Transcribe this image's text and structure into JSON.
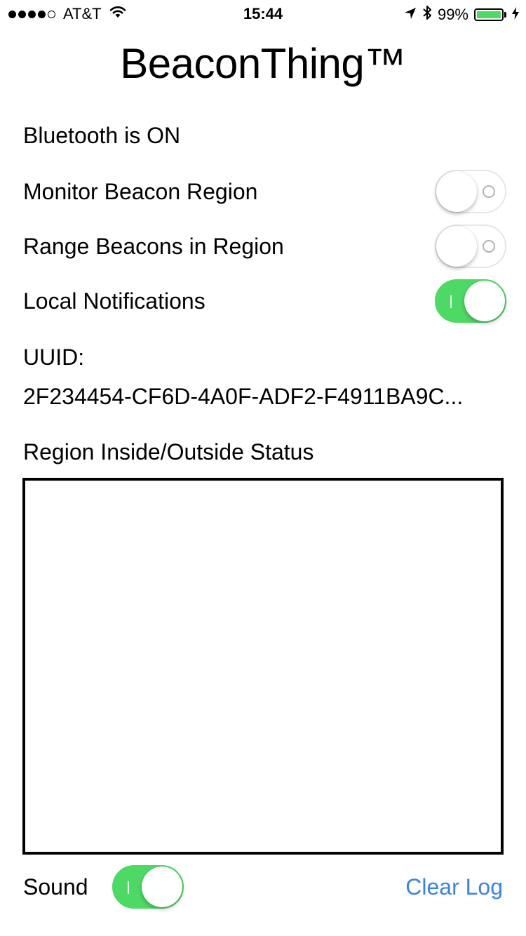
{
  "status_bar": {
    "carrier": "AT&T",
    "time": "15:44",
    "battery": "99%",
    "battery_level": 0.99,
    "battery_color": "#4cd964",
    "icons": [
      "signal-dots",
      "wifi-icon",
      "location-arrow-icon",
      "bluetooth-icon",
      "battery-icon",
      "charging-bolt-icon"
    ]
  },
  "title": "BeaconThing™",
  "bluetooth_status": "Bluetooth is ON",
  "settings": [
    {
      "label": "Monitor Beacon Region",
      "on": false
    },
    {
      "label": "Range Beacons in Region",
      "on": false
    },
    {
      "label": "Local Notifications",
      "on": true
    }
  ],
  "uuid": {
    "label": "UUID:",
    "value": "2F234454-CF6D-4A0F-ADF2-F4911BA9C..."
  },
  "region_status": {
    "label": "Region Inside/Outside Status",
    "log": ""
  },
  "footer": {
    "sound_label": "Sound",
    "sound_on": true,
    "clear_log": "Clear Log"
  },
  "colors": {
    "toggle_on": "#4cd964",
    "link": "#3a82e8"
  }
}
